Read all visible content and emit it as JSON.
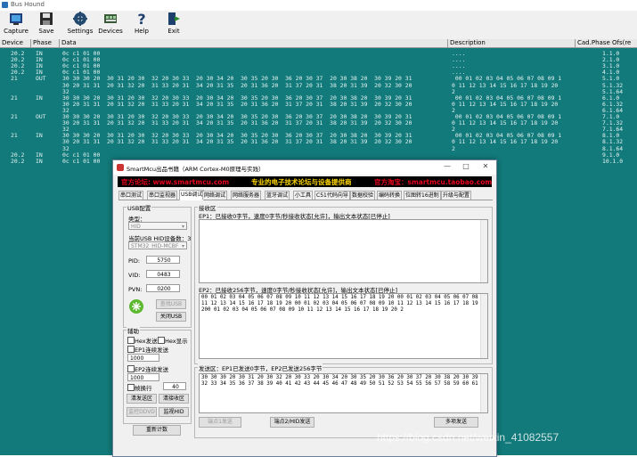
{
  "app": {
    "title": "Bus Hound"
  },
  "toolbar": [
    {
      "label": "Capture",
      "icon": "capture-icon"
    },
    {
      "label": "Save",
      "icon": "save-icon"
    },
    {
      "label": "Settings",
      "icon": "settings-icon"
    },
    {
      "label": "Devices",
      "icon": "devices-icon"
    },
    {
      "label": "Help",
      "icon": "help-icon"
    },
    {
      "label": "Exit",
      "icon": "exit-icon"
    }
  ],
  "columns": {
    "device": "Device",
    "phase": "Phase",
    "data": "Data",
    "description": "Description",
    "cad": "Cad.Phase Ofs(re"
  },
  "rows": [
    {
      "dev": "20.2",
      "ph": "IN",
      "data": "0c c1 01 00",
      "desc": "....",
      "cad": "1.1.0"
    },
    {
      "dev": "20.2",
      "ph": "IN",
      "data": "0c c1 01 00",
      "desc": "....",
      "cad": "2.1.0"
    },
    {
      "dev": "20.2",
      "ph": "IN",
      "data": "0c c1 01 00",
      "desc": "....",
      "cad": "3.1.0"
    },
    {
      "dev": "20.2",
      "ph": "IN",
      "data": "0c c1 01 00",
      "desc": "....",
      "cad": "4.1.0"
    },
    {
      "dev": "21",
      "ph": "OUT",
      "data": "30 30 30 20  30 31 20 30  32 20 30 33  20 30 34 20  30 35 20 30  36 20 30 37  20 30 38 20  30 39 20 31",
      "desc": " 00 01 02 03 04 05 06 07 08 09 1",
      "cad": "5.1.0"
    },
    {
      "dev": "",
      "ph": "",
      "data": "30 20 31 31  20 31 32 20  31 33 20 31  34 20 31 35  20 31 36 20  31 37 20 31  38 20 31 39  20 32 30 20",
      "desc": "0 11 12 13 14 15 16 17 18 19 20",
      "cad": "5.1.32"
    },
    {
      "dev": "",
      "ph": "",
      "data": "32",
      "desc": "2",
      "cad": "5.1.64"
    },
    {
      "dev": "21",
      "ph": "IN",
      "data": "30 30 30 20  30 31 20 30  32 20 30 33  20 30 34 20  30 35 20 30  36 20 30 37  20 30 38 20  30 39 20 31",
      "desc": " 00 01 02 03 04 05 06 07 08 09 1",
      "cad": "6.1.0"
    },
    {
      "dev": "",
      "ph": "",
      "data": "30 20 31 31  20 31 32 20  31 33 20 31  34 20 31 35  20 31 36 20  31 37 20 31  38 20 31 39  20 32 30 20",
      "desc": "0 11 12 13 14 15 16 17 18 19 20",
      "cad": "6.1.32"
    },
    {
      "dev": "",
      "ph": "",
      "data": "32",
      "desc": "2",
      "cad": "6.1.64"
    },
    {
      "dev": "21",
      "ph": "OUT",
      "data": "30 30 30 20  30 31 20 30  32 20 30 33  20 30 34 20  30 35 20 30  36 20 30 37  20 30 38 20  30 39 20 31",
      "desc": " 00 01 02 03 04 05 06 07 08 09 1",
      "cad": "7.1.0"
    },
    {
      "dev": "",
      "ph": "",
      "data": "30 20 31 31  20 31 32 20  31 33 20 31  34 20 31 35  20 31 36 20  31 37 20 31  38 20 31 39  20 32 30 20",
      "desc": "0 11 12 13 14 15 16 17 18 19 20",
      "cad": "7.1.32"
    },
    {
      "dev": "",
      "ph": "",
      "data": "32",
      "desc": "2",
      "cad": "7.1.64"
    },
    {
      "dev": "21",
      "ph": "IN",
      "data": "30 30 30 20  30 31 20 30  32 20 30 33  20 30 34 20  30 35 20 30  36 20 30 37  20 30 38 20  30 39 20 31",
      "desc": " 00 01 02 03 04 05 06 07 08 09 1",
      "cad": "8.1.0"
    },
    {
      "dev": "",
      "ph": "",
      "data": "30 20 31 31  20 31 32 20  31 33 20 31  34 20 31 35  20 31 36 20  31 37 20 31  38 20 31 39  20 32 30 20",
      "desc": "0 11 12 13 14 15 16 17 18 19 20",
      "cad": "8.1.32"
    },
    {
      "dev": "",
      "ph": "",
      "data": "32",
      "desc": "2",
      "cad": "8.1.64"
    },
    {
      "dev": "20.2",
      "ph": "IN",
      "data": "0c c1 01 00",
      "desc": "",
      "cad": "9.1.0"
    },
    {
      "dev": "20.2",
      "ph": "IN",
      "data": "0c c1 01 00",
      "desc": "",
      "cad": "10.1.0"
    }
  ],
  "dialog": {
    "title": "SmartMcu出品书籍（ARM Cortex-M0原理与实践）",
    "banner1": "官方论坛: www.smartmcu.com",
    "banner2": "专业的电子技术论坛与设备提供商",
    "banner3": "官方淘宝：smartmcu.taobao.com",
    "tabs": [
      "串口测试",
      "串口监视器",
      "USB调试",
      "网络调试",
      "网络服务器",
      "蓝牙调试",
      "小工具",
      "C51代码向导",
      "数据校验",
      "编码转换",
      "位图转16进制",
      "升级与配置"
    ],
    "active_tab": 2,
    "usb_group": "USB配置",
    "type_label": "类型：",
    "type_value": "HID",
    "device_count_label": "当前USB HID设备数：3",
    "device_value": "STM32_HID-MCBF",
    "pid_label": "PID:",
    "pid_value": "5750",
    "vid_label": "VID:",
    "vid_value": "0483",
    "pvn_label": "PVN:",
    "pvn_value": "0200",
    "find_btn": "查找USB",
    "close_btn": "关闭USB",
    "assist_group": "辅助",
    "hex_send": "Hex发送",
    "hex_show": "Hex显示",
    "ep1_loop": "EP1连续发送",
    "ep1_val": "1000",
    "ep2_loop": "EP2连续发送",
    "ep2_val": "1000",
    "frame_label": "帧换行",
    "frame_val": "40",
    "clear_send": "清发送区",
    "clear_recv": "清接收区",
    "monitor_ddvd": "监控DDVD",
    "monitor_hid": "监视HID",
    "reset_count": "重新计数",
    "recv_group": "接收区",
    "ep1_status": "EP1：已接收0字节，速度0字节/秒接收状态[允许]，输出文本状态[已停止]",
    "ep2_status": "EP2：已接收256字节，速度0字节/秒接收状态[允许]，输出文本状态[已停止]",
    "recv_text": "00 01 02 03 04 05 06 07 08 09 10 11 12 13 14 15 16 17 18 19 20 00 01 02 03 04 05 06 07 08 09 10\n11 12 13 14 15 16 17 18 19 20 00 01 02 03 04 05 06 07 08 09 10 11 12 13 14 15 16 17 18 19 20\n200 01 02 03 04 05 06 07 08 09 10 11 12 13 14 15 16 17 18 19 20 2",
    "send_group": "发送区：EP1已发送0字节，EP2已发送256字节",
    "send_text": "30 30 30 20 30 31 20 30 32 20 30 33 20 30 34 20 30 35 20 30 36 20 30 37 20 30 38 20 30 39 20 31\n32 33 34 35 36 37 38 39 40 41 42 43 44 45 46 47 48 49 50 51 52 53 54 55 56 57 58 59 60 61 62 63",
    "ep1_send": "端点1发送",
    "ep2_send": "端点2/HID发送",
    "multi_send": "多项发送"
  },
  "watermark": "https://blog.csdn.net/weixin_41082557",
  "colors": {
    "grid_bg": "#127a7a",
    "banner_red": "#e8001e",
    "banner_yellow": "#ffd700"
  }
}
